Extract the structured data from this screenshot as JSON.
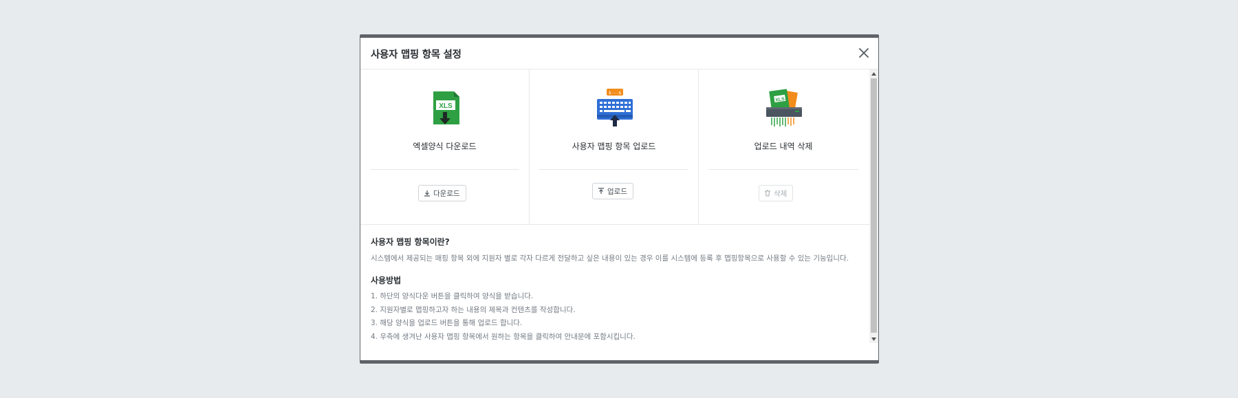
{
  "modal": {
    "title": "사용자 맵핑 항목 설정"
  },
  "cards": [
    {
      "title": "엑셀양식 다운로드",
      "button_label": "다운로드",
      "icon": "excel-download-icon"
    },
    {
      "title": "사용자 맵핑 항목 업로드",
      "button_label": "업로드",
      "icon": "keyboard-upload-icon"
    },
    {
      "title": "업로드 내역 삭제",
      "button_label": "삭제",
      "icon": "shredder-delete-icon"
    }
  ],
  "info": {
    "heading": "사용자 맵핑 항목이란?",
    "description": "시스템에서 제공되는 매핑 항목 외에 지원자 별로 각자 다르게 전달하고 싶은 내용이 있는 경우 이를 시스템에 등록 후 맵핑항목으로 사용할 수 있는 기능입니다.",
    "usage_heading": "사용방법",
    "steps": [
      "1. 하단의 양식다운 버튼을 클릭하여 양식을 받습니다.",
      "2. 지원자별로 맵핑하고자 하는 내용의 제목과 컨텐츠를 작성합니다.",
      "3. 해당 양식을 업로드 버튼을 통해 업로드 합니다.",
      "4. 우측에 생겨난 사용자 맵핑 항목에서 원하는 항목을 클릭하여 안내문에 포함시킵니다."
    ]
  },
  "colors": {
    "excel_green": "#2ea043",
    "keyboard_blue": "#2f6fd6",
    "accent_orange": "#f28c1b"
  }
}
